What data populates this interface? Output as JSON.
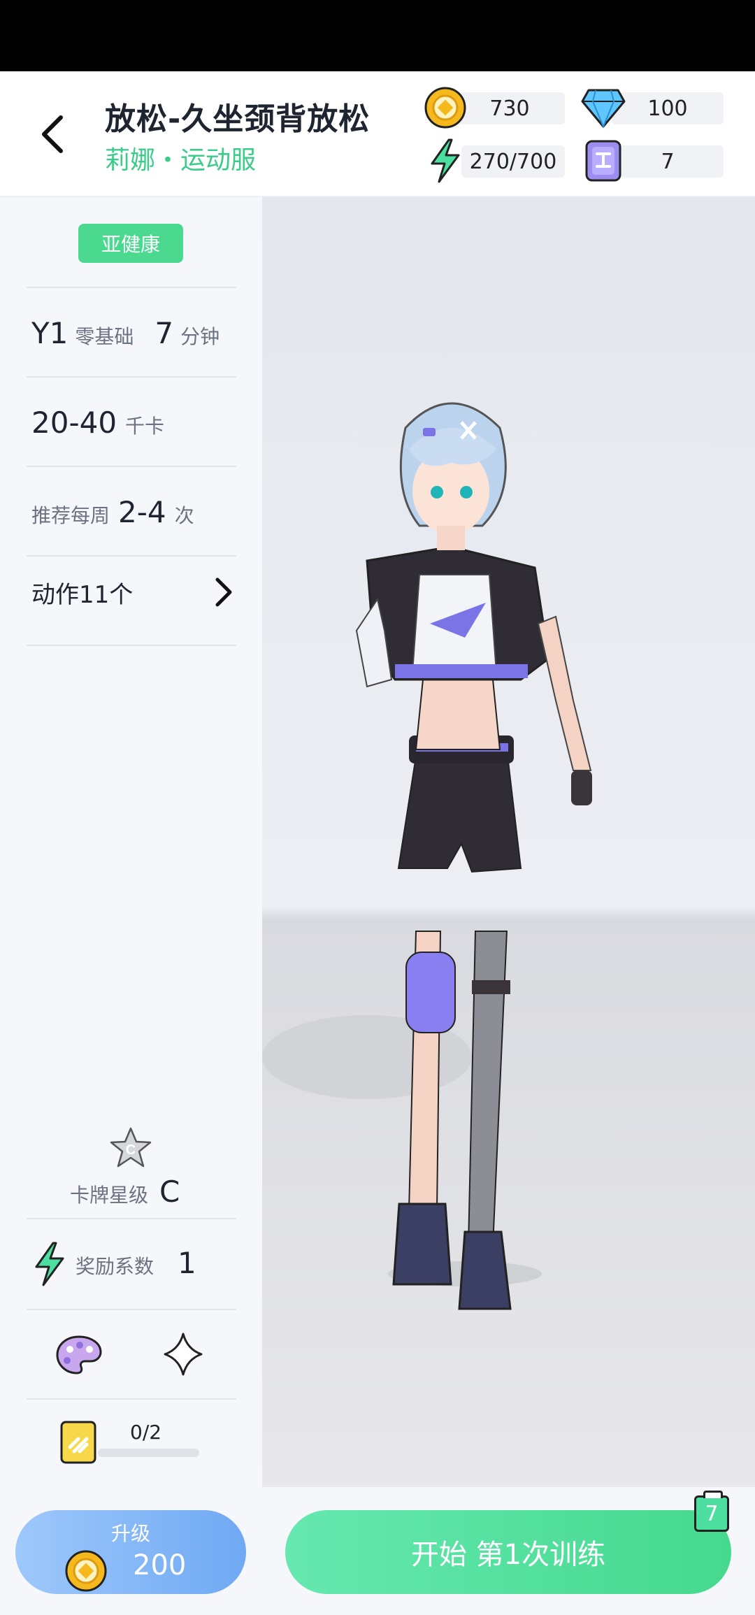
{
  "header": {
    "title": "放松-久坐颈背放松",
    "subtitle": "莉娜・运动服"
  },
  "resources": {
    "coins": "730",
    "diamonds": "100",
    "energy": "270/700",
    "tickets": "7"
  },
  "sidebar": {
    "health_badge": "亚健康",
    "level_code": "Y1",
    "level_desc": "零基础",
    "duration_value": "7",
    "duration_unit": "分钟",
    "calories_value": "20-40",
    "calories_unit": "千卡",
    "weekly_label": "推荐每周",
    "weekly_value": "2-4",
    "weekly_unit": "次",
    "actions_label": "动作11个",
    "card_star_badge": "C",
    "card_star_label": "卡牌星级",
    "card_star_value": "C",
    "reward_label": "奖励系数",
    "reward_value": "1",
    "fragment_progress": "0/2",
    "fragment_fraction": 0
  },
  "bottom": {
    "upgrade_label": "升级",
    "upgrade_cost": "200",
    "start_label": "开始 第1次训练",
    "clipboard_badge": "7"
  },
  "colors": {
    "accent_green": "#3ccc8a",
    "upgrade_blue": "#6fa9f3",
    "coin_gold": "#f5b91e",
    "diamond_blue": "#5fc6ff",
    "ticket_purple": "#9b8ef0"
  }
}
